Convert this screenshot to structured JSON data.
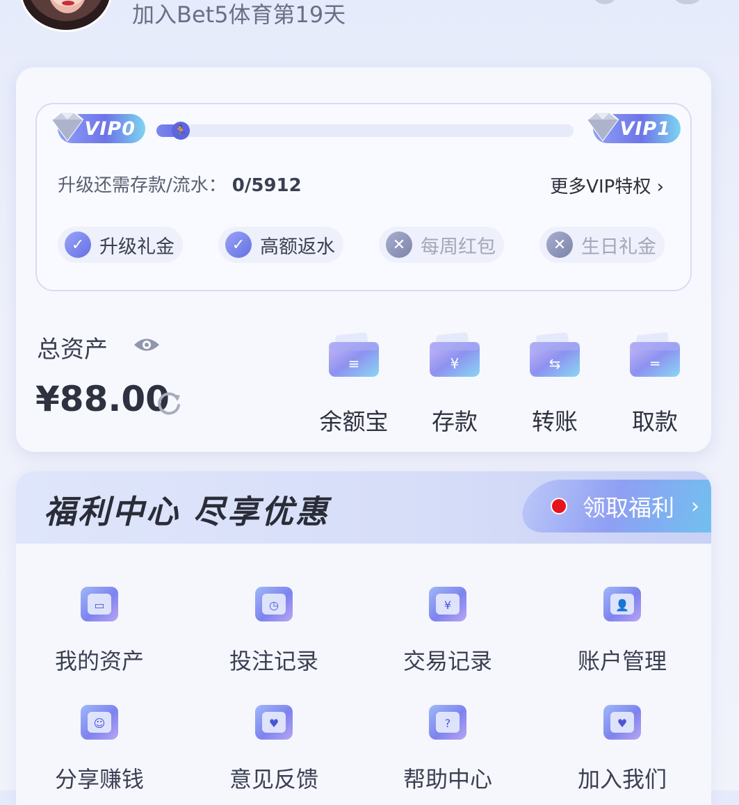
{
  "header": {
    "join_text": "加入Bet5体育第19天"
  },
  "vip": {
    "current_level": "VIP0",
    "next_level": "VIP1",
    "progress": 0.08,
    "upgrade_label": "升级还需存款/流水：",
    "upgrade_value": "0/5912",
    "more_privileges": "更多VIP特权",
    "perks": [
      {
        "label": "升级礼金",
        "enabled": true
      },
      {
        "label": "高额返水",
        "enabled": true
      },
      {
        "label": "每周红包",
        "enabled": false
      },
      {
        "label": "生日礼金",
        "enabled": false
      }
    ]
  },
  "assets": {
    "label": "总资产",
    "balance": "¥88.00",
    "actions": [
      {
        "label": "余额宝",
        "icon": "yuebao-wallet-icon"
      },
      {
        "label": "存款",
        "icon": "deposit-wallet-icon"
      },
      {
        "label": "转账",
        "icon": "transfer-wallet-icon"
      },
      {
        "label": "取款",
        "icon": "withdraw-wallet-icon"
      }
    ]
  },
  "welfare": {
    "title": "福利中心  尽享优惠",
    "claim_label": "领取福利",
    "items": [
      {
        "label": "我的资产",
        "icon": "my-assets-card-icon"
      },
      {
        "label": "投注记录",
        "icon": "bet-record-calendar-icon"
      },
      {
        "label": "交易记录",
        "icon": "transaction-record-icon"
      },
      {
        "label": "账户管理",
        "icon": "account-management-icon"
      },
      {
        "label": "分享赚钱",
        "icon": "share-earn-icon"
      },
      {
        "label": "意见反馈",
        "icon": "feedback-envelope-icon"
      },
      {
        "label": "帮助中心",
        "icon": "help-center-icon"
      },
      {
        "label": "加入我们",
        "icon": "join-us-icon"
      }
    ]
  },
  "colors": {
    "accent": "#6470e4",
    "notification_dot": "#e6141d"
  }
}
